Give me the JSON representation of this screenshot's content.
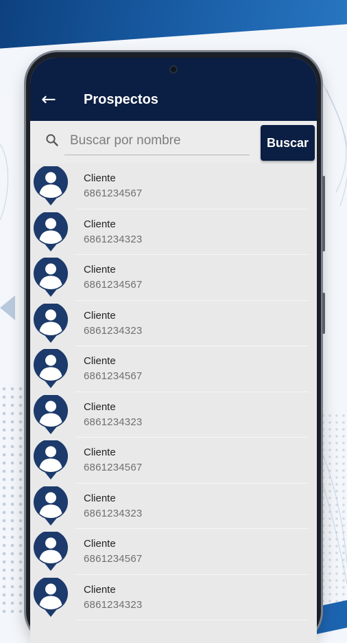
{
  "header": {
    "title": "Prospectos",
    "back_icon": "arrow-left-icon"
  },
  "search": {
    "placeholder": "Buscar por nombre",
    "value": "",
    "button_label": "Buscar",
    "icon": "search-icon"
  },
  "colors": {
    "primary": "#0b1e43",
    "avatar": "#1c3a6b",
    "list_bg": "#e9e9e9"
  },
  "prospects": [
    {
      "name": "Cliente",
      "phone": "6861234567"
    },
    {
      "name": "Cliente",
      "phone": "6861234323"
    },
    {
      "name": "Cliente",
      "phone": "6861234567"
    },
    {
      "name": "Cliente",
      "phone": "6861234323"
    },
    {
      "name": "Cliente",
      "phone": "6861234567"
    },
    {
      "name": "Cliente",
      "phone": "6861234323"
    },
    {
      "name": "Cliente",
      "phone": "6861234567"
    },
    {
      "name": "Cliente",
      "phone": "6861234323"
    },
    {
      "name": "Cliente",
      "phone": "6861234567"
    },
    {
      "name": "Cliente",
      "phone": "6861234323"
    }
  ]
}
